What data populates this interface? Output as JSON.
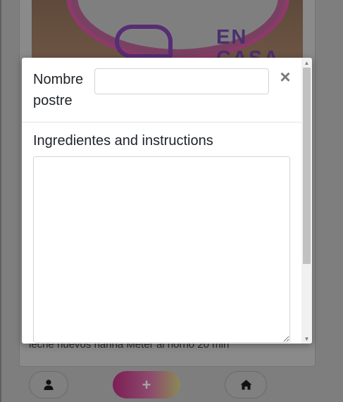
{
  "background": {
    "photo_logo_text_line1": "EN",
    "photo_logo_text_line2": "CASA",
    "recipe_text": "leche huevos harina Meter al horno 20 min",
    "nav": {
      "user_icon": "user-icon",
      "add_label": "+",
      "home_icon": "home-icon"
    }
  },
  "modal": {
    "title_label": "Nombre postre",
    "title_input_value": "",
    "close_label": "×",
    "instructions_label": "Ingredientes and instructions",
    "instructions_value": ""
  },
  "colors": {
    "overlay": "#7e7e7e",
    "modal_bg": "#ffffff",
    "accent_pink": "#e91e8c",
    "accent_yellow": "#f0f07a"
  }
}
